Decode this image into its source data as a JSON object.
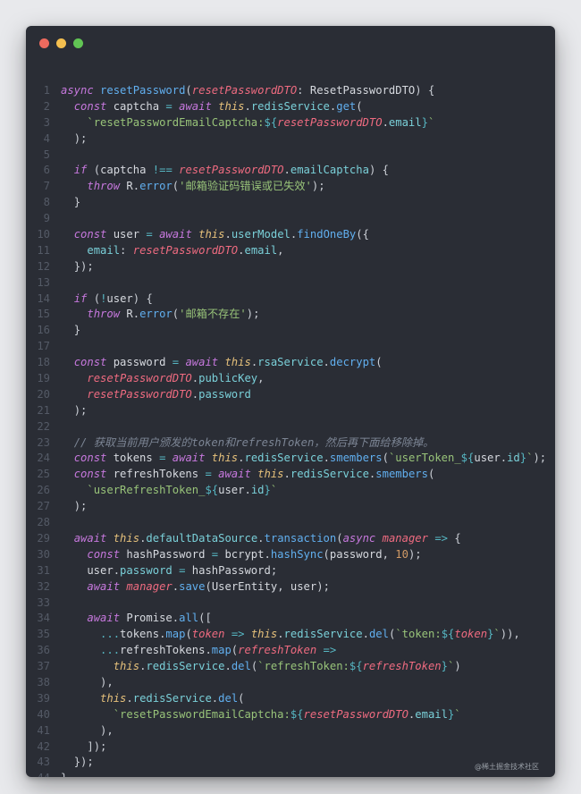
{
  "window": {
    "traffic_lights": [
      {
        "name": "close",
        "color": "#ed6a5e"
      },
      {
        "name": "minimize",
        "color": "#f4bf4f"
      },
      {
        "name": "maximize",
        "color": "#61c554"
      }
    ]
  },
  "code_lines": [
    {
      "n": "1",
      "tokens": [
        [
          "kw",
          "async"
        ],
        [
          "t",
          " "
        ],
        [
          "fn",
          "resetPassword"
        ],
        [
          "punc",
          "("
        ],
        [
          "param",
          "resetPasswordDTO"
        ],
        [
          "punc",
          ": "
        ],
        [
          "t",
          "ResetPasswordDTO"
        ],
        [
          "punc",
          ") {"
        ]
      ]
    },
    {
      "n": "2",
      "tokens": [
        [
          "t",
          "  "
        ],
        [
          "kw",
          "const"
        ],
        [
          "t",
          " captcha "
        ],
        [
          "op",
          "="
        ],
        [
          "t",
          " "
        ],
        [
          "kw",
          "await"
        ],
        [
          "t",
          " "
        ],
        [
          "this",
          "this"
        ],
        [
          "punc",
          "."
        ],
        [
          "prop",
          "redisService"
        ],
        [
          "punc",
          "."
        ],
        [
          "fn",
          "get"
        ],
        [
          "punc",
          "("
        ]
      ]
    },
    {
      "n": "3",
      "tokens": [
        [
          "t",
          "    "
        ],
        [
          "str",
          "`resetPasswordEmailCaptcha:"
        ],
        [
          "op",
          "${"
        ],
        [
          "param",
          "resetPasswordDTO"
        ],
        [
          "punc",
          "."
        ],
        [
          "prop",
          "email"
        ],
        [
          "op",
          "}"
        ],
        [
          "str",
          "`"
        ]
      ]
    },
    {
      "n": "4",
      "tokens": [
        [
          "t",
          "  "
        ],
        [
          "punc",
          ");"
        ]
      ]
    },
    {
      "n": "5",
      "tokens": []
    },
    {
      "n": "6",
      "tokens": [
        [
          "t",
          "  "
        ],
        [
          "kw",
          "if"
        ],
        [
          "punc",
          " ("
        ],
        [
          "t",
          "captcha "
        ],
        [
          "op",
          "!=="
        ],
        [
          "t",
          " "
        ],
        [
          "param",
          "resetPasswordDTO"
        ],
        [
          "punc",
          "."
        ],
        [
          "prop",
          "emailCaptcha"
        ],
        [
          "punc",
          ") {"
        ]
      ]
    },
    {
      "n": "7",
      "tokens": [
        [
          "t",
          "    "
        ],
        [
          "kw",
          "throw"
        ],
        [
          "t",
          " R"
        ],
        [
          "punc",
          "."
        ],
        [
          "fn",
          "error"
        ],
        [
          "punc",
          "("
        ],
        [
          "str",
          "'邮箱验证码错误或已失效'"
        ],
        [
          "punc",
          ");"
        ]
      ]
    },
    {
      "n": "8",
      "tokens": [
        [
          "t",
          "  "
        ],
        [
          "punc",
          "}"
        ]
      ]
    },
    {
      "n": "9",
      "tokens": []
    },
    {
      "n": "10",
      "tokens": [
        [
          "t",
          "  "
        ],
        [
          "kw",
          "const"
        ],
        [
          "t",
          " user "
        ],
        [
          "op",
          "="
        ],
        [
          "t",
          " "
        ],
        [
          "kw",
          "await"
        ],
        [
          "t",
          " "
        ],
        [
          "this",
          "this"
        ],
        [
          "punc",
          "."
        ],
        [
          "prop",
          "userModel"
        ],
        [
          "punc",
          "."
        ],
        [
          "fn",
          "findOneBy"
        ],
        [
          "punc",
          "({"
        ]
      ]
    },
    {
      "n": "11",
      "tokens": [
        [
          "t",
          "    "
        ],
        [
          "prop",
          "email"
        ],
        [
          "punc",
          ": "
        ],
        [
          "param",
          "resetPasswordDTO"
        ],
        [
          "punc",
          "."
        ],
        [
          "prop",
          "email"
        ],
        [
          "punc",
          ","
        ]
      ]
    },
    {
      "n": "12",
      "tokens": [
        [
          "t",
          "  "
        ],
        [
          "punc",
          "});"
        ]
      ]
    },
    {
      "n": "13",
      "tokens": []
    },
    {
      "n": "14",
      "tokens": [
        [
          "t",
          "  "
        ],
        [
          "kw",
          "if"
        ],
        [
          "punc",
          " ("
        ],
        [
          "op",
          "!"
        ],
        [
          "t",
          "user"
        ],
        [
          "punc",
          ") {"
        ]
      ]
    },
    {
      "n": "15",
      "tokens": [
        [
          "t",
          "    "
        ],
        [
          "kw",
          "throw"
        ],
        [
          "t",
          " R"
        ],
        [
          "punc",
          "."
        ],
        [
          "fn",
          "error"
        ],
        [
          "punc",
          "("
        ],
        [
          "str",
          "'邮箱不存在'"
        ],
        [
          "punc",
          ");"
        ]
      ]
    },
    {
      "n": "16",
      "tokens": [
        [
          "t",
          "  "
        ],
        [
          "punc",
          "}"
        ]
      ]
    },
    {
      "n": "17",
      "tokens": []
    },
    {
      "n": "18",
      "tokens": [
        [
          "t",
          "  "
        ],
        [
          "kw",
          "const"
        ],
        [
          "t",
          " password "
        ],
        [
          "op",
          "="
        ],
        [
          "t",
          " "
        ],
        [
          "kw",
          "await"
        ],
        [
          "t",
          " "
        ],
        [
          "this",
          "this"
        ],
        [
          "punc",
          "."
        ],
        [
          "prop",
          "rsaService"
        ],
        [
          "punc",
          "."
        ],
        [
          "fn",
          "decrypt"
        ],
        [
          "punc",
          "("
        ]
      ]
    },
    {
      "n": "19",
      "tokens": [
        [
          "t",
          "    "
        ],
        [
          "param",
          "resetPasswordDTO"
        ],
        [
          "punc",
          "."
        ],
        [
          "prop",
          "publicKey"
        ],
        [
          "punc",
          ","
        ]
      ]
    },
    {
      "n": "20",
      "tokens": [
        [
          "t",
          "    "
        ],
        [
          "param",
          "resetPasswordDTO"
        ],
        [
          "punc",
          "."
        ],
        [
          "prop",
          "password"
        ]
      ]
    },
    {
      "n": "21",
      "tokens": [
        [
          "t",
          "  "
        ],
        [
          "punc",
          ");"
        ]
      ]
    },
    {
      "n": "22",
      "tokens": []
    },
    {
      "n": "23",
      "tokens": [
        [
          "t",
          "  "
        ],
        [
          "com",
          "// 获取当前用户颁发的token和refreshToken，然后再下面给移除掉。"
        ]
      ]
    },
    {
      "n": "24",
      "tokens": [
        [
          "t",
          "  "
        ],
        [
          "kw",
          "const"
        ],
        [
          "t",
          " tokens "
        ],
        [
          "op",
          "="
        ],
        [
          "t",
          " "
        ],
        [
          "kw",
          "await"
        ],
        [
          "t",
          " "
        ],
        [
          "this",
          "this"
        ],
        [
          "punc",
          "."
        ],
        [
          "prop",
          "redisService"
        ],
        [
          "punc",
          "."
        ],
        [
          "fn",
          "smembers"
        ],
        [
          "punc",
          "("
        ],
        [
          "str",
          "`userToken_"
        ],
        [
          "op",
          "${"
        ],
        [
          "t",
          "user"
        ],
        [
          "punc",
          "."
        ],
        [
          "prop",
          "id"
        ],
        [
          "op",
          "}"
        ],
        [
          "str",
          "`"
        ],
        [
          "punc",
          ");"
        ]
      ]
    },
    {
      "n": "25",
      "tokens": [
        [
          "t",
          "  "
        ],
        [
          "kw",
          "const"
        ],
        [
          "t",
          " refreshTokens "
        ],
        [
          "op",
          "="
        ],
        [
          "t",
          " "
        ],
        [
          "kw",
          "await"
        ],
        [
          "t",
          " "
        ],
        [
          "this",
          "this"
        ],
        [
          "punc",
          "."
        ],
        [
          "prop",
          "redisService"
        ],
        [
          "punc",
          "."
        ],
        [
          "fn",
          "smembers"
        ],
        [
          "punc",
          "("
        ]
      ]
    },
    {
      "n": "26",
      "tokens": [
        [
          "t",
          "    "
        ],
        [
          "str",
          "`userRefreshToken_"
        ],
        [
          "op",
          "${"
        ],
        [
          "t",
          "user"
        ],
        [
          "punc",
          "."
        ],
        [
          "prop",
          "id"
        ],
        [
          "op",
          "}"
        ],
        [
          "str",
          "`"
        ]
      ]
    },
    {
      "n": "27",
      "tokens": [
        [
          "t",
          "  "
        ],
        [
          "punc",
          ");"
        ]
      ]
    },
    {
      "n": "28",
      "tokens": []
    },
    {
      "n": "29",
      "tokens": [
        [
          "t",
          "  "
        ],
        [
          "kw",
          "await"
        ],
        [
          "t",
          " "
        ],
        [
          "this",
          "this"
        ],
        [
          "punc",
          "."
        ],
        [
          "prop",
          "defaultDataSource"
        ],
        [
          "punc",
          "."
        ],
        [
          "fn",
          "transaction"
        ],
        [
          "punc",
          "("
        ],
        [
          "kw",
          "async"
        ],
        [
          "t",
          " "
        ],
        [
          "param",
          "manager"
        ],
        [
          "t",
          " "
        ],
        [
          "op",
          "=>"
        ],
        [
          "punc",
          " {"
        ]
      ]
    },
    {
      "n": "30",
      "tokens": [
        [
          "t",
          "    "
        ],
        [
          "kw",
          "const"
        ],
        [
          "t",
          " hashPassword "
        ],
        [
          "op",
          "="
        ],
        [
          "t",
          " bcrypt"
        ],
        [
          "punc",
          "."
        ],
        [
          "fn",
          "hashSync"
        ],
        [
          "punc",
          "("
        ],
        [
          "t",
          "password"
        ],
        [
          "punc",
          ", "
        ],
        [
          "num",
          "10"
        ],
        [
          "punc",
          ");"
        ]
      ]
    },
    {
      "n": "31",
      "tokens": [
        [
          "t",
          "    user"
        ],
        [
          "punc",
          "."
        ],
        [
          "prop",
          "password"
        ],
        [
          "t",
          " "
        ],
        [
          "op",
          "="
        ],
        [
          "t",
          " hashPassword"
        ],
        [
          "punc",
          ";"
        ]
      ]
    },
    {
      "n": "32",
      "tokens": [
        [
          "t",
          "    "
        ],
        [
          "kw",
          "await"
        ],
        [
          "t",
          " "
        ],
        [
          "param",
          "manager"
        ],
        [
          "punc",
          "."
        ],
        [
          "fn",
          "save"
        ],
        [
          "punc",
          "("
        ],
        [
          "t",
          "UserEntity"
        ],
        [
          "punc",
          ", "
        ],
        [
          "t",
          "user"
        ],
        [
          "punc",
          ");"
        ]
      ]
    },
    {
      "n": "33",
      "tokens": []
    },
    {
      "n": "34",
      "tokens": [
        [
          "t",
          "    "
        ],
        [
          "kw",
          "await"
        ],
        [
          "t",
          " Promise"
        ],
        [
          "punc",
          "."
        ],
        [
          "fn",
          "all"
        ],
        [
          "punc",
          "(["
        ]
      ]
    },
    {
      "n": "35",
      "tokens": [
        [
          "t",
          "      "
        ],
        [
          "op",
          "..."
        ],
        [
          "t",
          "tokens"
        ],
        [
          "punc",
          "."
        ],
        [
          "fn",
          "map"
        ],
        [
          "punc",
          "("
        ],
        [
          "param",
          "token"
        ],
        [
          "t",
          " "
        ],
        [
          "op",
          "=>"
        ],
        [
          "t",
          " "
        ],
        [
          "this",
          "this"
        ],
        [
          "punc",
          "."
        ],
        [
          "prop",
          "redisService"
        ],
        [
          "punc",
          "."
        ],
        [
          "fn",
          "del"
        ],
        [
          "punc",
          "("
        ],
        [
          "str",
          "`token:"
        ],
        [
          "op",
          "${"
        ],
        [
          "param",
          "token"
        ],
        [
          "op",
          "}"
        ],
        [
          "str",
          "`"
        ],
        [
          "punc",
          ")),"
        ]
      ]
    },
    {
      "n": "36",
      "tokens": [
        [
          "t",
          "      "
        ],
        [
          "op",
          "..."
        ],
        [
          "t",
          "refreshTokens"
        ],
        [
          "punc",
          "."
        ],
        [
          "fn",
          "map"
        ],
        [
          "punc",
          "("
        ],
        [
          "param",
          "refreshToken"
        ],
        [
          "t",
          " "
        ],
        [
          "op",
          "=>"
        ]
      ]
    },
    {
      "n": "37",
      "tokens": [
        [
          "t",
          "        "
        ],
        [
          "this",
          "this"
        ],
        [
          "punc",
          "."
        ],
        [
          "prop",
          "redisService"
        ],
        [
          "punc",
          "."
        ],
        [
          "fn",
          "del"
        ],
        [
          "punc",
          "("
        ],
        [
          "str",
          "`refreshToken:"
        ],
        [
          "op",
          "${"
        ],
        [
          "param",
          "refreshToken"
        ],
        [
          "op",
          "}"
        ],
        [
          "str",
          "`"
        ],
        [
          "punc",
          ")"
        ]
      ]
    },
    {
      "n": "38",
      "tokens": [
        [
          "t",
          "      "
        ],
        [
          "punc",
          "),"
        ]
      ]
    },
    {
      "n": "39",
      "tokens": [
        [
          "t",
          "      "
        ],
        [
          "this",
          "this"
        ],
        [
          "punc",
          "."
        ],
        [
          "prop",
          "redisService"
        ],
        [
          "punc",
          "."
        ],
        [
          "fn",
          "del"
        ],
        [
          "punc",
          "("
        ]
      ]
    },
    {
      "n": "40",
      "tokens": [
        [
          "t",
          "        "
        ],
        [
          "str",
          "`resetPasswordEmailCaptcha:"
        ],
        [
          "op",
          "${"
        ],
        [
          "param",
          "resetPasswordDTO"
        ],
        [
          "punc",
          "."
        ],
        [
          "prop",
          "email"
        ],
        [
          "op",
          "}"
        ],
        [
          "str",
          "`"
        ]
      ]
    },
    {
      "n": "41",
      "tokens": [
        [
          "t",
          "      "
        ],
        [
          "punc",
          "),"
        ]
      ]
    },
    {
      "n": "42",
      "tokens": [
        [
          "t",
          "    "
        ],
        [
          "punc",
          "]);"
        ]
      ]
    },
    {
      "n": "43",
      "tokens": [
        [
          "t",
          "  "
        ],
        [
          "punc",
          "});"
        ]
      ]
    },
    {
      "n": "44",
      "tokens": [
        [
          "punc",
          "}"
        ]
      ]
    }
  ],
  "watermark": "@稀土掘金技术社区"
}
